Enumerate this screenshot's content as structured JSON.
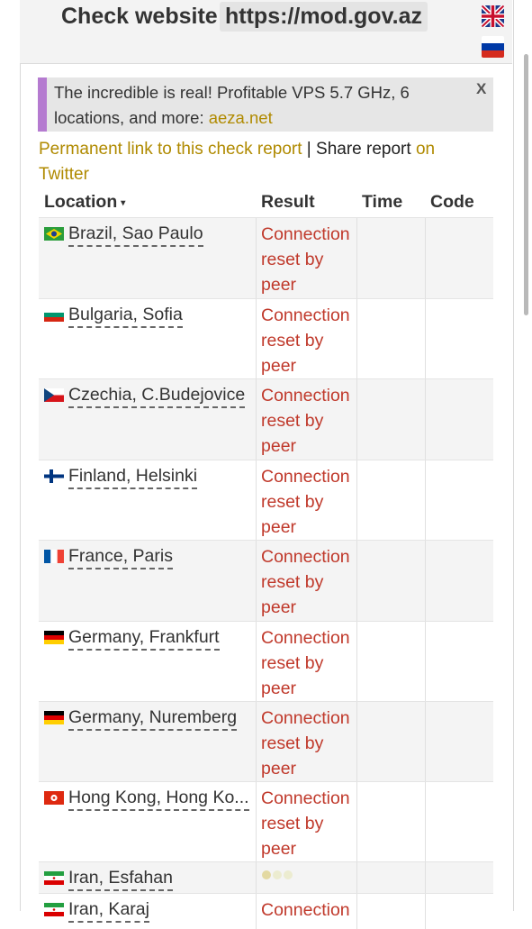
{
  "header": {
    "title_prefix": "Check website",
    "url": "https://mod.gov.az",
    "languages": [
      {
        "name": "english-flag-icon"
      },
      {
        "name": "russian-flag-icon"
      }
    ]
  },
  "ad": {
    "text": "The incredible is real! Profitable VPS 5.7 GHz, 6 locations, and more: ",
    "link": "aeza.net",
    "close": "X",
    "accent_color": "#b57bd0"
  },
  "report": {
    "permalink": "Permanent link to this check report",
    "separator": " | ",
    "share": "Share report ",
    "twitter": "on Twitter"
  },
  "table": {
    "headers": {
      "location": "Location",
      "sort_arrow": "▾",
      "result": "Result",
      "time": "Time",
      "code": "Code"
    },
    "rows": [
      {
        "location": "Brazil, Sao Paulo",
        "flag": "brazil-flag-icon",
        "result": "Connection reset by peer"
      },
      {
        "location": "Bulgaria, Sofia",
        "flag": "bulgaria-flag-icon",
        "result": "Connection reset by peer"
      },
      {
        "location": "Czechia, C.Budejovice",
        "flag": "czechia-flag-icon",
        "result": "Connection reset by peer"
      },
      {
        "location": "Finland, Helsinki",
        "flag": "finland-flag-icon",
        "result": "Connection reset by peer"
      },
      {
        "location": "France, Paris",
        "flag": "france-flag-icon",
        "result": "Connection reset by peer"
      },
      {
        "location": "Germany, Frankfurt",
        "flag": "germany-flag-icon",
        "result": "Connection reset by peer"
      },
      {
        "location": "Germany, Nuremberg",
        "flag": "germany-flag-icon",
        "result": "Connection reset by peer"
      },
      {
        "location": "Hong Kong, Hong Ko...",
        "flag": "hong-kong-flag-icon",
        "result": "Connection reset by peer"
      },
      {
        "location": "Iran, Esfahan",
        "flag": "iran-flag-icon",
        "result": ""
      },
      {
        "location": "Iran, Karaj",
        "flag": "iran-flag-icon",
        "result": "Connection"
      }
    ],
    "error_color": "#c0392b",
    "link_color": "#b08a00"
  }
}
